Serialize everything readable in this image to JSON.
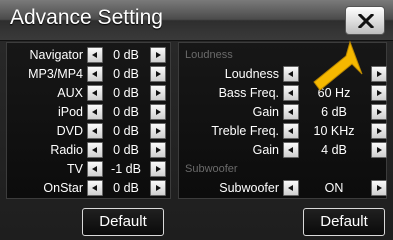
{
  "header": {
    "title": "Advance Setting",
    "close_icon": "close-icon"
  },
  "left": {
    "rows": [
      {
        "label": "Navigator",
        "value": "0 dB"
      },
      {
        "label": "MP3/MP4",
        "value": "0 dB"
      },
      {
        "label": "AUX",
        "value": "0 dB"
      },
      {
        "label": "iPod",
        "value": "0 dB"
      },
      {
        "label": "DVD",
        "value": "0 dB"
      },
      {
        "label": "Radio",
        "value": "0 dB"
      },
      {
        "label": "TV",
        "value": "-1 dB"
      },
      {
        "label": "OnStar",
        "value": "0 dB"
      }
    ],
    "default_label": "Default"
  },
  "right": {
    "loudness_section": "Loudness",
    "rows": [
      {
        "label": "Loudness",
        "value": ""
      },
      {
        "label": "Bass Freq.",
        "value": "60 Hz"
      },
      {
        "label": "Gain",
        "value": "6 dB"
      },
      {
        "label": "Treble Freq.",
        "value": "10 KHz"
      },
      {
        "label": "Gain",
        "value": "4 dB"
      }
    ],
    "subwoofer_section": "Subwoofer",
    "subwoofer": {
      "label": "Subwoofer",
      "value": "ON"
    },
    "default_label": "Default"
  },
  "colors": {
    "hint_arrow": "#f5b800",
    "section_text": "#6a6a6a"
  },
  "icons": {
    "decrease": "left-arrow-icon",
    "increase": "right-arrow-icon",
    "hint": "yellow-pointer-arrow-icon"
  }
}
